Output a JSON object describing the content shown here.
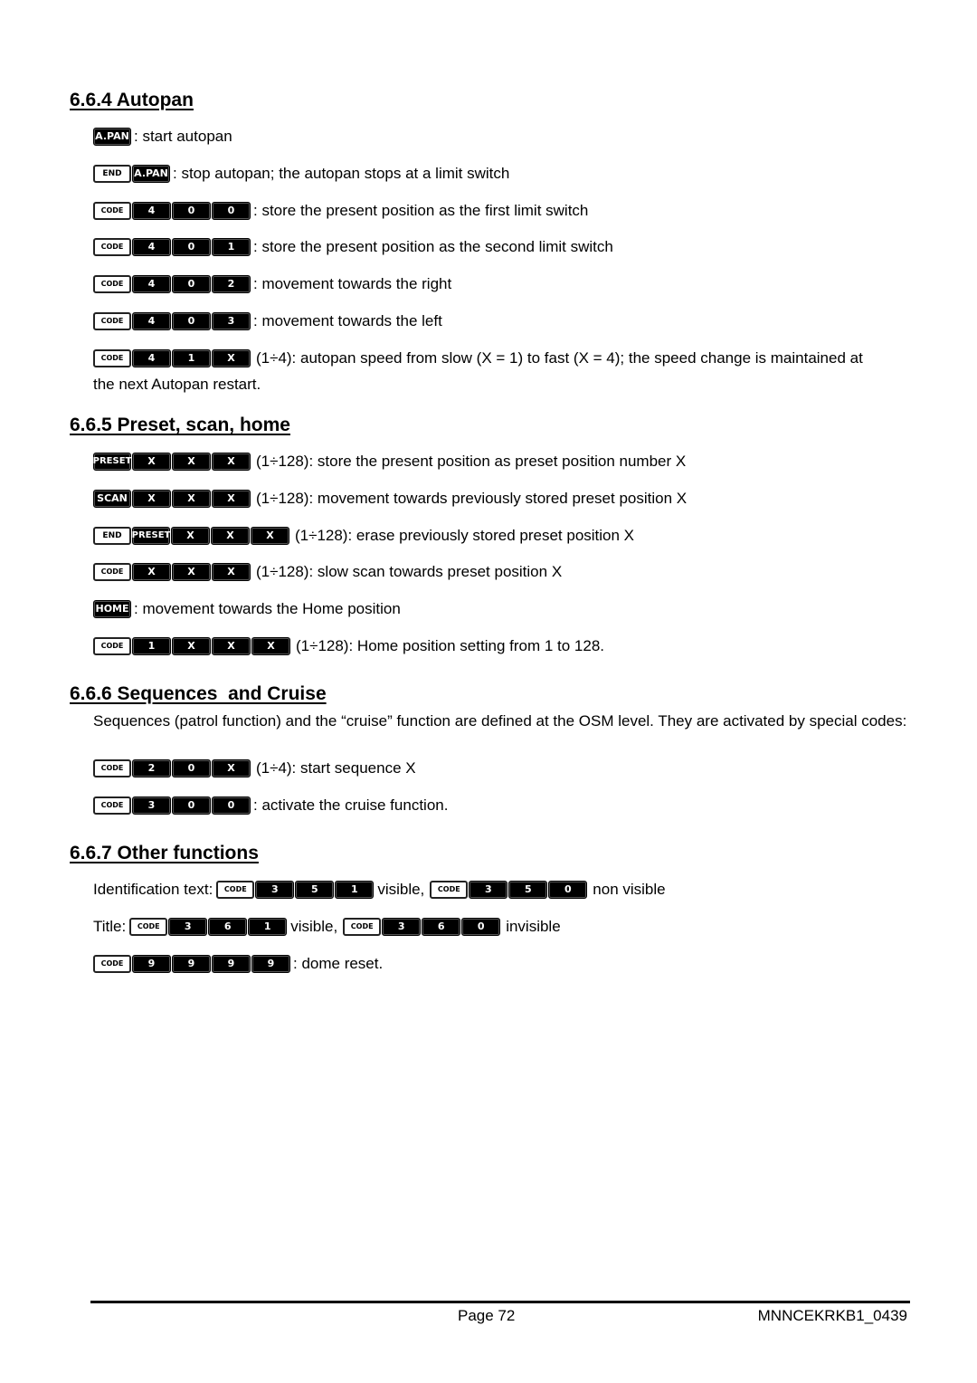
{
  "sections": {
    "autopan": {
      "heading": "6.6.4 Autopan",
      "rows": [
        {
          "keys": [
            "A.PAN"
          ],
          "text": ": start autopan"
        },
        {
          "keys": [
            "END",
            "A.PAN"
          ],
          "text": ": stop autopan; the autopan stops at a limit switch"
        },
        {
          "keys": [
            "CODE",
            "4",
            "0",
            "0"
          ],
          "text": ": store the present position as the first limit switch"
        },
        {
          "keys": [
            "CODE",
            "4",
            "0",
            "1"
          ],
          "text": ": store the present position as the second limit switch"
        },
        {
          "keys": [
            "CODE",
            "4",
            "0",
            "2"
          ],
          "text": ": movement towards the right"
        },
        {
          "keys": [
            "CODE",
            "4",
            "0",
            "3"
          ],
          "text": ": movement towards the left"
        },
        {
          "keys": [
            "CODE",
            "4",
            "1",
            "X"
          ],
          "text": "(1÷4): autopan speed from slow (X = 1) to fast (X = 4); the speed change is maintained at",
          "continuation": "the next Autopan restart."
        }
      ]
    },
    "preset": {
      "heading": "6.6.5 Preset, scan, home",
      "rows": [
        {
          "keys": [
            "PRESET",
            "X",
            "X",
            "X"
          ],
          "text": "(1÷128): store the present position as preset position number X"
        },
        {
          "keys": [
            "SCAN",
            "X",
            "X",
            "X"
          ],
          "text": "(1÷128): movement towards previously stored preset position X"
        },
        {
          "keys": [
            "END",
            "PRESET",
            "X",
            "X",
            "X"
          ],
          "text": "(1÷128): erase previously stored preset position X"
        },
        {
          "keys": [
            "CODE",
            "X",
            "X",
            "X"
          ],
          "text": "(1÷128): slow scan towards preset position X"
        },
        {
          "keys": [
            "HOME"
          ],
          "text": ": movement towards the Home position"
        },
        {
          "keys": [
            "CODE",
            "1",
            "X",
            "X",
            "X"
          ],
          "text": "(1÷128): Home position setting from 1 to 128."
        }
      ]
    },
    "sequences": {
      "heading": "6.6.6 Sequences  and Cruise",
      "intro": "Sequences (patrol function) and the “cruise” function are defined at the OSM level. They are activated by special codes:",
      "rows": [
        {
          "keys": [
            "CODE",
            "2",
            "0",
            "X"
          ],
          "text": "(1÷4): start sequence X"
        },
        {
          "keys": [
            "CODE",
            "3",
            "0",
            "0"
          ],
          "text": ": activate the cruise function."
        }
      ]
    },
    "other": {
      "heading": "6.6.7 Other functions",
      "identification": {
        "label": "Identification text:",
        "visible_keys": [
          "CODE",
          "3",
          "5",
          "1"
        ],
        "visible_text": "visible,",
        "hidden_keys": [
          "CODE",
          "3",
          "5",
          "0"
        ],
        "hidden_text": "non visible"
      },
      "title": {
        "label": "Title:",
        "visible_keys": [
          "CODE",
          "3",
          "6",
          "1"
        ],
        "visible_text": "visible,",
        "hidden_keys": [
          "CODE",
          "3",
          "6",
          "0"
        ],
        "hidden_text": "invisible"
      },
      "reset": {
        "keys": [
          "CODE",
          "9",
          "9",
          "9",
          "9"
        ],
        "text": ": dome reset."
      }
    }
  },
  "footer": {
    "page": "Page 72",
    "doc_code": "MNNCEKRKB1_0439"
  }
}
